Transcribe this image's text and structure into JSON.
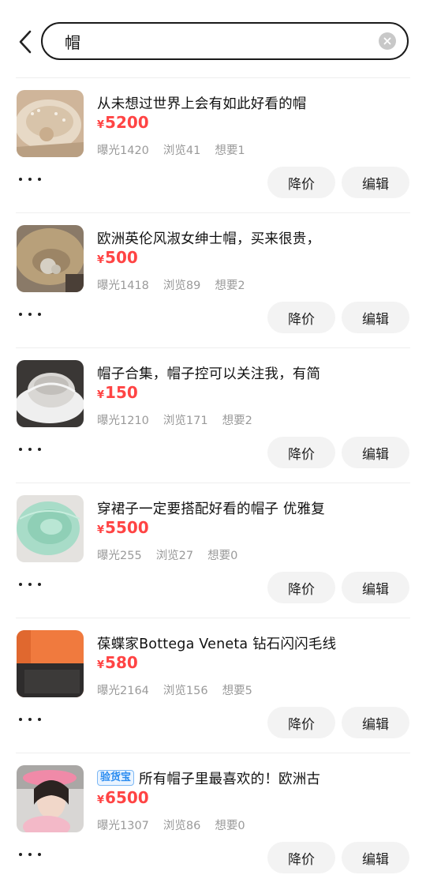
{
  "search": {
    "value": "帽"
  },
  "actions": {
    "reduce_price": "降价",
    "edit": "编辑"
  },
  "items": [
    {
      "title": "从未想过世界上会有如此好看的帽",
      "tag": "",
      "currency": "¥",
      "price": "5200",
      "exposure": "曝光1420",
      "views": "浏览41",
      "wants": "想要1"
    },
    {
      "title": "欧洲英伦风淑女绅士帽，买来很贵，",
      "tag": "",
      "currency": "¥",
      "price": "500",
      "exposure": "曝光1418",
      "views": "浏览89",
      "wants": "想要2"
    },
    {
      "title": "帽子合集，帽子控可以关注我，有简",
      "tag": "",
      "currency": "¥",
      "price": "150",
      "exposure": "曝光1210",
      "views": "浏览171",
      "wants": "想要2"
    },
    {
      "title": "穿裙子一定要搭配好看的帽子 优雅复",
      "tag": "",
      "currency": "¥",
      "price": "5500",
      "exposure": "曝光255",
      "views": "浏览27",
      "wants": "想要0"
    },
    {
      "title": "葆蝶家Bottega Veneta 钻石闪闪毛线",
      "tag": "",
      "currency": "¥",
      "price": "580",
      "exposure": "曝光2164",
      "views": "浏览156",
      "wants": "想要5"
    },
    {
      "title": "所有帽子里最喜欢的！欧洲古",
      "tag": "验货宝",
      "currency": "¥",
      "price": "6500",
      "exposure": "曝光1307",
      "views": "浏览86",
      "wants": "想要0"
    }
  ]
}
